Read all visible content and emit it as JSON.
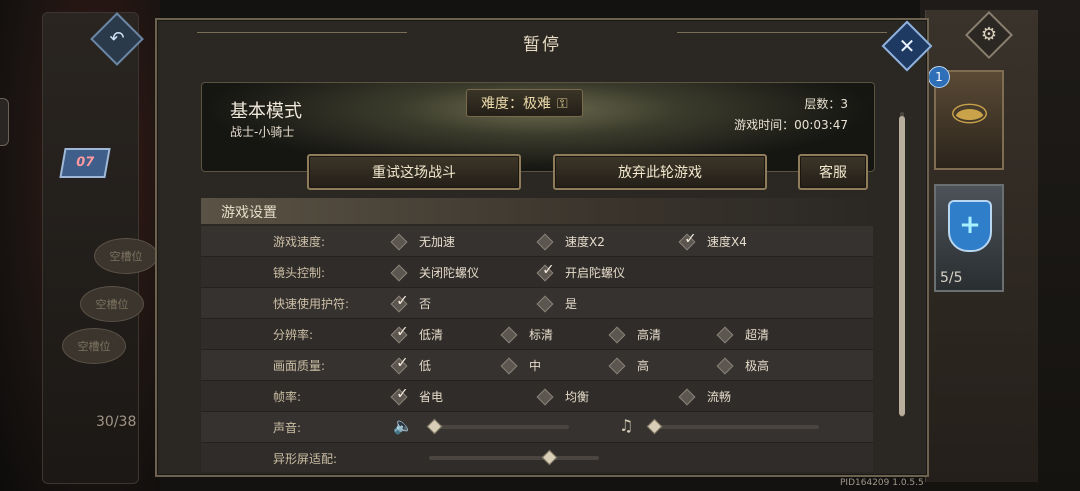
{
  "modal": {
    "title": "暂停",
    "mode_title": "基本模式",
    "mode_sub": "战士-小骑士",
    "difficulty": "难度：极难",
    "floor": "层数：3",
    "time": "游戏时间：00:03:47",
    "close_icon": "close-icon"
  },
  "actions": {
    "retry": "重试这场战斗",
    "abandon": "放弃此轮游戏",
    "service": "客服"
  },
  "settings": {
    "title": "游戏设置",
    "rows": [
      {
        "label": "游戏速度:",
        "options": [
          {
            "text": "无加速",
            "checked": false
          },
          {
            "text": "速度X2",
            "checked": false
          },
          {
            "text": "速度X4",
            "checked": true
          }
        ]
      },
      {
        "label": "镜头控制:",
        "options": [
          {
            "text": "关闭陀螺仪",
            "checked": false
          },
          {
            "text": "开启陀螺仪",
            "checked": true
          }
        ]
      },
      {
        "label": "快速使用护符:",
        "options": [
          {
            "text": "否",
            "checked": true
          },
          {
            "text": "是",
            "checked": false
          }
        ]
      },
      {
        "label": "分辨率:",
        "options": [
          {
            "text": "低清",
            "checked": true
          },
          {
            "text": "标清",
            "checked": false
          },
          {
            "text": "高清",
            "checked": false
          },
          {
            "text": "超清",
            "checked": false
          }
        ]
      },
      {
        "label": "画面质量:",
        "options": [
          {
            "text": "低",
            "checked": true
          },
          {
            "text": "中",
            "checked": false
          },
          {
            "text": "高",
            "checked": false
          },
          {
            "text": "极高",
            "checked": false
          }
        ]
      },
      {
        "label": "帧率:",
        "options": [
          {
            "text": "省电",
            "checked": true
          },
          {
            "text": "均衡",
            "checked": false
          },
          {
            "text": "流畅",
            "checked": false
          }
        ]
      },
      {
        "label": "声音:",
        "sound_level": 0.0,
        "music_level": 0.0
      },
      {
        "label": "异形屏适配:",
        "screen_adapt_level": 0.7
      }
    ]
  },
  "background": {
    "slots": [
      "空槽位",
      "空槽位",
      "空槽位"
    ],
    "badge_level": "07",
    "card_count": "30/38",
    "relic_badge": "1",
    "shield_count": "5/5"
  },
  "version": "PID164209  1.0.5.5"
}
